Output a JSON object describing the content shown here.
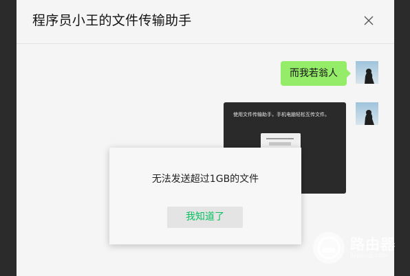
{
  "window": {
    "title": "程序员小王的文件传输助手",
    "close_icon": "close-icon"
  },
  "messages": [
    {
      "type": "text",
      "text": "而我若翁人",
      "bubble_color": "#95ec69",
      "avatar_icon": "avatar"
    },
    {
      "type": "image",
      "caption": "使用文件传输助手，手机电脑轻松互传文件。",
      "avatar_icon": "avatar"
    }
  ],
  "dialog": {
    "message": "无法发送超过1GB的文件",
    "button_label": "我知道了",
    "button_color": "#07c160"
  },
  "watermark": {
    "text": "路由器",
    "subtext": "luyouqi.com"
  },
  "colors": {
    "background": "#2b2b2b",
    "window": "#f5f5f5",
    "accent_green": "#07c160"
  }
}
